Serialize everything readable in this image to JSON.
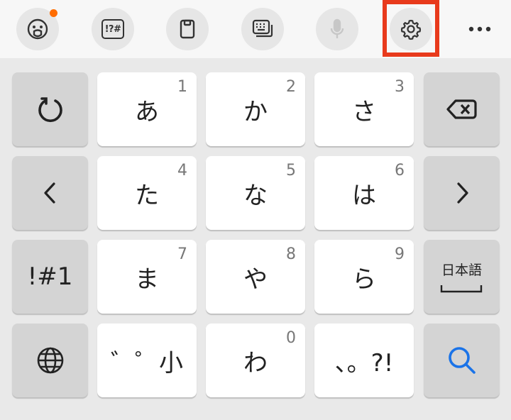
{
  "toolbar": {
    "icons": [
      "emoji-icon",
      "symbols-icon",
      "clipboard-icon",
      "keyboard-mode-icon",
      "microphone-icon",
      "settings-icon",
      "more-icon"
    ],
    "symbols_label": "!?#",
    "highlight_color": "#e83a1c",
    "badge_color": "#ff6d00"
  },
  "keys": {
    "row1": {
      "k1": "あ",
      "n1": "1",
      "k2": "か",
      "n2": "2",
      "k3": "さ",
      "n3": "3"
    },
    "row2": {
      "k1": "た",
      "n1": "4",
      "k2": "な",
      "n2": "5",
      "k3": "は",
      "n3": "6"
    },
    "row3": {
      "k1": "ま",
      "n1": "7",
      "k2": "や",
      "n2": "8",
      "k3": "ら",
      "n3": "9"
    },
    "row4": {
      "k1": "゛゜小",
      "k2": "わ",
      "n2": "0",
      "k3": "、。?!"
    },
    "symbols_key": "!#1",
    "language_key": "日本語"
  },
  "colors": {
    "accent_search": "#1a73e8",
    "func_key": "#d4d4d4",
    "char_key": "#ffffff"
  }
}
